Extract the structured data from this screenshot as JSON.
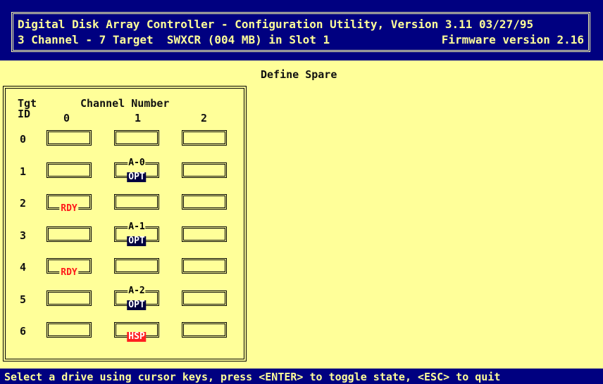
{
  "header": {
    "line1": "Digital Disk Array Controller - Configuration Utility, Version 3.11 03/27/95",
    "line2_left": "3 Channel - 7 Target  SWXCR (004 MB) in Slot 1",
    "line2_right": "Firmware version 2.16"
  },
  "mode_title": "Define Spare",
  "grid": {
    "tgt_label": "Tgt",
    "id_label": "ID",
    "channel_label": "Channel Number",
    "channels": [
      "0",
      "1",
      "2"
    ],
    "rows": [
      {
        "id": "0",
        "slots": [
          {
            "top": "",
            "state": ""
          },
          {
            "top": "",
            "state": ""
          },
          {
            "top": "",
            "state": ""
          }
        ]
      },
      {
        "id": "1",
        "slots": [
          {
            "top": "",
            "state": ""
          },
          {
            "top": "A-0",
            "state": "OPT"
          },
          {
            "top": "",
            "state": ""
          }
        ]
      },
      {
        "id": "2",
        "slots": [
          {
            "top": "",
            "state": "RDY"
          },
          {
            "top": "",
            "state": ""
          },
          {
            "top": "",
            "state": ""
          }
        ]
      },
      {
        "id": "3",
        "slots": [
          {
            "top": "",
            "state": ""
          },
          {
            "top": "A-1",
            "state": "OPT"
          },
          {
            "top": "",
            "state": ""
          }
        ]
      },
      {
        "id": "4",
        "slots": [
          {
            "top": "",
            "state": "RDY"
          },
          {
            "top": "",
            "state": ""
          },
          {
            "top": "",
            "state": ""
          }
        ]
      },
      {
        "id": "5",
        "slots": [
          {
            "top": "",
            "state": ""
          },
          {
            "top": "A-2",
            "state": "OPT"
          },
          {
            "top": "",
            "state": ""
          }
        ]
      },
      {
        "id": "6",
        "slots": [
          {
            "top": "",
            "state": ""
          },
          {
            "top": "",
            "state": "HSP"
          },
          {
            "top": "",
            "state": ""
          }
        ]
      }
    ]
  },
  "status_bar": "Select a drive using cursor keys, press <ENTER> to toggle state, <ESC> to quit",
  "colors": {
    "background": "#FFFF99",
    "header_bg": "#000080",
    "rdy": "#ff1a1a",
    "opt_bg": "#000040",
    "hsp_bg": "#ff2020"
  }
}
